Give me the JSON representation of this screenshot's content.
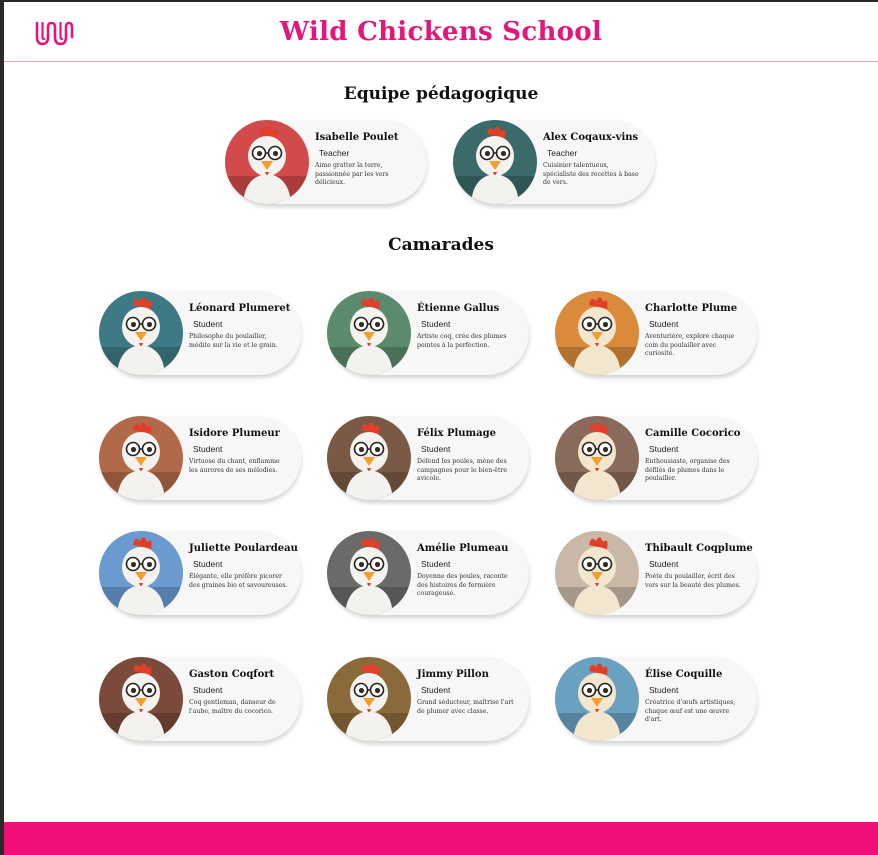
{
  "header": {
    "title": "Wild Chickens School",
    "logo_icon": "ww-wave-logo"
  },
  "teachers": {
    "heading": "Equipe pédagogique",
    "members": [
      {
        "name": "Isabelle Poulet",
        "role": "Teacher",
        "description": "Aime gratter la terre, passionnée par les vers délicieux."
      },
      {
        "name": "Alex Coqaux-vins",
        "role": "Teacher",
        "description": "Cuisinier talentueux, spécialiste des recettes à base de vers."
      }
    ]
  },
  "students": {
    "heading": "Camarades",
    "members": [
      {
        "name": "Léonard Plumeret",
        "role": "Student",
        "description": "Philosophe du poulailler, médite sur la vie et le grain."
      },
      {
        "name": "Étienne Gallus",
        "role": "Student",
        "description": "Artiste coq, crée des plumes peintes à la perfection."
      },
      {
        "name": "Charlotte Plume",
        "role": "Student",
        "description": "Aventurière, explore chaque coin du poulailler avec curiosité."
      },
      {
        "name": "Isidore Plumeur",
        "role": "Student",
        "description": "Virtuose du chant, enflamme les aurores de ses mélodies."
      },
      {
        "name": "Félix Plumage",
        "role": "Student",
        "description": "Défend les poules, mène des campagnes pour le bien-être avicole."
      },
      {
        "name": "Camille Cocorico",
        "role": "Student",
        "description": "Enthousiaste, organise des défilés de plumes dans le poulailler."
      },
      {
        "name": "Juliette Poulardeau",
        "role": "Student",
        "description": "Élégante, elle préfère picorer des graines bio et savoureuses."
      },
      {
        "name": "Amélie Plumeau",
        "role": "Student",
        "description": "Doyenne des poules, raconte des histoires de fermière courageuse."
      },
      {
        "name": "Thibault Coqplume",
        "role": "Student",
        "description": "Poète du poulailler, écrit des vers sur la beauté des plumes."
      },
      {
        "name": "Gaston Coqfort",
        "role": "Student",
        "description": "Coq gentleman, danseur de l'aube, maître du cocorico."
      },
      {
        "name": "Jimmy Pillon",
        "role": "Student",
        "description": "Grand séducteur, maîtrise l'art de plumer avec classe."
      },
      {
        "name": "Élise Coquille",
        "role": "Student",
        "description": "Créatrice d'œufs artistiques, chaque œuf est une œuvre d'art."
      }
    ]
  },
  "colors": {
    "brand": "#e4167a",
    "footer": "#f1107a",
    "card": "#f7f7f7"
  }
}
